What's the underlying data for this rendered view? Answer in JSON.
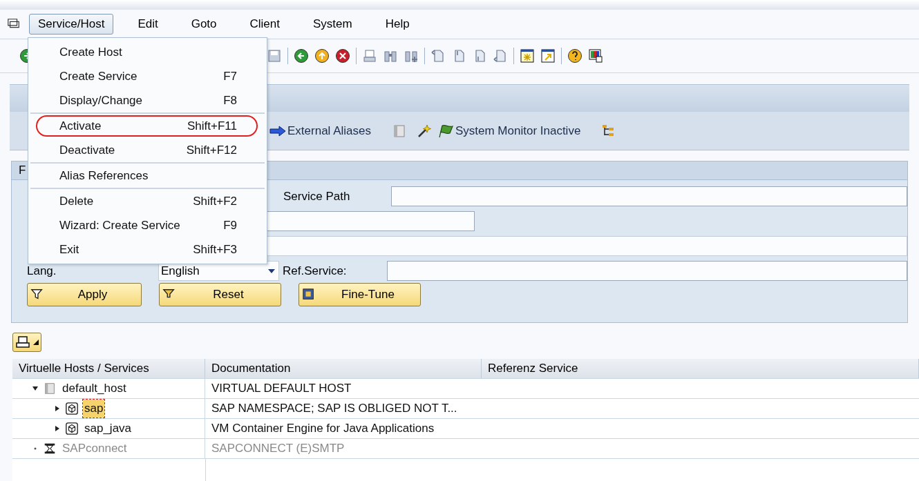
{
  "menubar": {
    "items": [
      {
        "label": "Service/Host",
        "selected": true
      },
      {
        "label": "Edit",
        "selected": false
      },
      {
        "label": "Goto",
        "selected": false
      },
      {
        "label": "Client",
        "selected": false
      },
      {
        "label": "System",
        "selected": false
      },
      {
        "label": "Help",
        "selected": false
      }
    ]
  },
  "menu": {
    "groups": [
      [
        {
          "label": "Create Host",
          "circled": false
        },
        {
          "label": "Create Service",
          "shortcut": "F7",
          "circled": false
        },
        {
          "label": "Display/Change",
          "shortcut": "F8",
          "circled": false
        }
      ],
      [
        {
          "label": "Activate",
          "shortcut": "Shift+F11",
          "circled": true
        },
        {
          "label": "Deactivate",
          "shortcut": "Shift+F12",
          "circled": false
        }
      ],
      [
        {
          "label": "Alias References",
          "circled": false
        }
      ],
      [
        {
          "label": "Delete",
          "shortcut": "Shift+F2",
          "circled": false
        },
        {
          "label": "Wizard: Create Service",
          "shortcut": "F9",
          "circled": false
        },
        {
          "label": "Exit",
          "shortcut": "Shift+F3",
          "circled": false
        }
      ]
    ]
  },
  "app_toolbar": {
    "external_aliases": "External Aliases",
    "system_monitor": "System Monitor Inactive"
  },
  "filter": {
    "header": "F",
    "service_path_label": "Service Path",
    "lang_label": "Lang.",
    "lang_value": "English",
    "ref_service_label": "Ref.Service:",
    "buttons": [
      "Apply",
      "Reset",
      "Fine-Tune"
    ]
  },
  "table": {
    "columns": [
      "Virtuelle Hosts / Services",
      "Documentation",
      "Referenz Service"
    ],
    "rows": [
      {
        "name": "default_host",
        "documentation": "VIRTUAL DEFAULT HOST",
        "kind": "host",
        "expandable": true,
        "expanded": true,
        "selected": false,
        "disabled": false,
        "children": [
          {
            "name": "sap",
            "documentation": "SAP NAMESPACE; SAP IS OBLIGED NOT T...",
            "kind": "service",
            "expandable": true,
            "expanded": false,
            "selected": true,
            "disabled": false
          },
          {
            "name": "sap_java",
            "documentation": "VM Container Engine for Java Applications",
            "kind": "service",
            "expandable": true,
            "expanded": false,
            "selected": false,
            "disabled": false
          }
        ]
      },
      {
        "name": "SAPconnect",
        "documentation": "SAPCONNECT (E)SMTP",
        "kind": "connect",
        "expandable": false,
        "expanded": false,
        "selected": false,
        "disabled": true
      }
    ]
  }
}
